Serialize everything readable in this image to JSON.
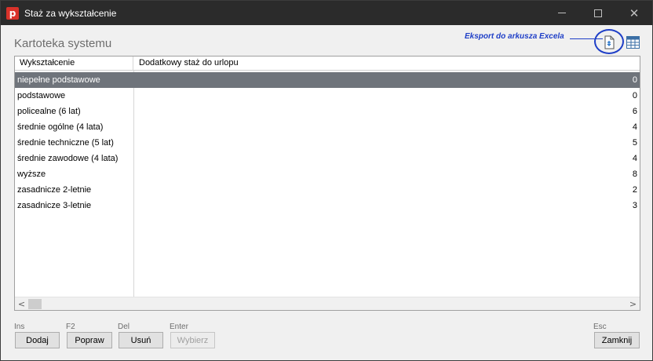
{
  "window": {
    "title": "Staż za wykształcenie",
    "app_icon_letter": "p"
  },
  "section_title": "Kartoteka systemu",
  "annotation": {
    "excel_label": "Eksport do arkusza Excela"
  },
  "icons": {
    "export": "excel-export-icon",
    "table": "table-view-icon"
  },
  "columns": [
    "Wykształcenie",
    "Dodatkowy staż do urlopu"
  ],
  "rows": [
    {
      "name": "niepełne podstawowe",
      "value": "0"
    },
    {
      "name": "podstawowe",
      "value": "0"
    },
    {
      "name": "policealne (6 lat)",
      "value": "6"
    },
    {
      "name": "średnie ogólne (4 lata)",
      "value": "4"
    },
    {
      "name": "średnie techniczne (5 lat)",
      "value": "5"
    },
    {
      "name": "średnie zawodowe (4 lata)",
      "value": "4"
    },
    {
      "name": "wyższe",
      "value": "8"
    },
    {
      "name": "zasadnicze 2-letnie",
      "value": "2"
    },
    {
      "name": "zasadnicze 3-letnie",
      "value": "3"
    }
  ],
  "selected_row": 0,
  "buttons": {
    "add": {
      "key": "Ins",
      "label": "Dodaj"
    },
    "edit": {
      "key": "F2",
      "label": "Popraw"
    },
    "delete": {
      "key": "Del",
      "label": "Usuń"
    },
    "select": {
      "key": "Enter",
      "label": "Wybierz"
    },
    "close": {
      "key": "Esc",
      "label": "Zamknij"
    }
  },
  "colors": {
    "accent": "#1f3fc7",
    "selection": "#6f747b",
    "titlebar": "#2b2b2b",
    "app_icon": "#d9322a"
  }
}
